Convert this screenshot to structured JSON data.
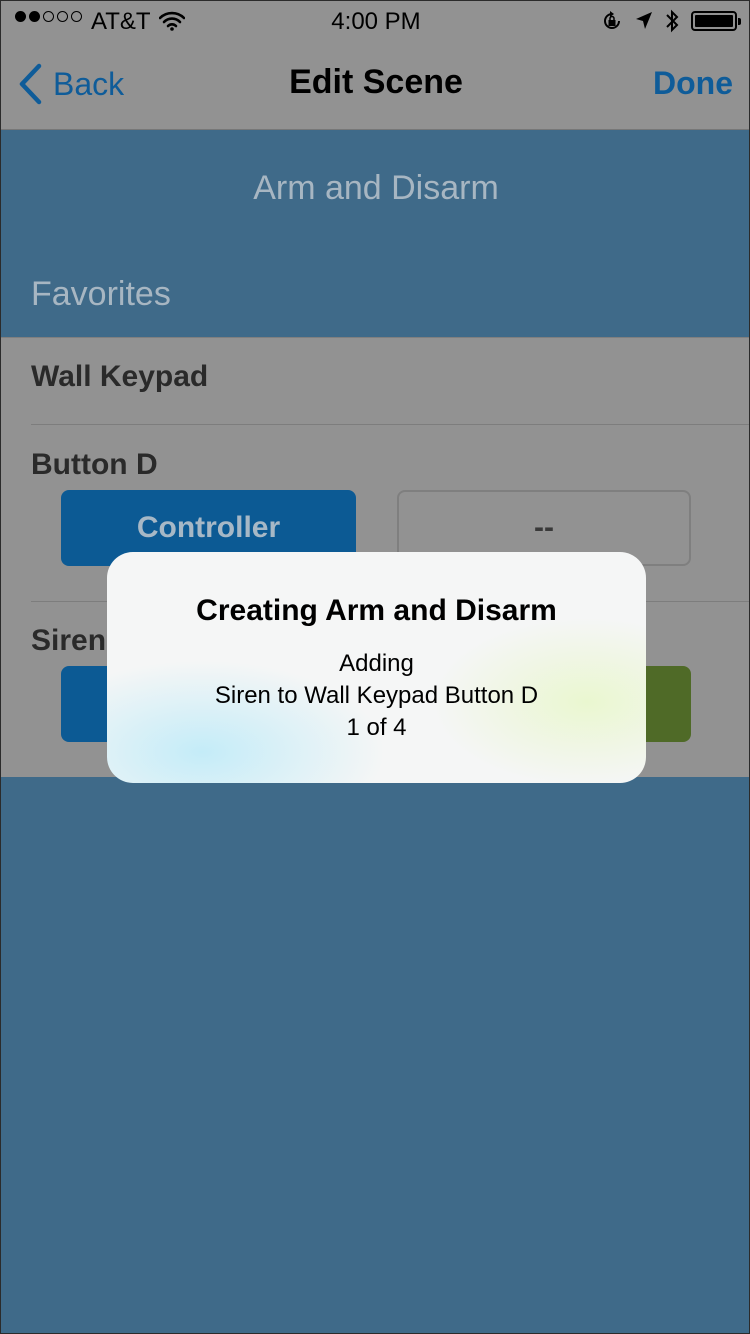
{
  "status_bar": {
    "carrier": "AT&T",
    "time": "4:00 PM",
    "signal_bars_filled": 2,
    "signal_bars_total": 5,
    "icons": [
      "signal-icon",
      "wifi-icon",
      "rotation-lock-icon",
      "location-icon",
      "bluetooth-icon",
      "battery-icon"
    ]
  },
  "nav": {
    "back_label": "Back",
    "title": "Edit Scene",
    "done_label": "Done"
  },
  "scene": {
    "name": "Arm and Disarm",
    "section_label": "Favorites"
  },
  "rows": [
    {
      "title": "Wall Keypad"
    },
    {
      "title": "Button D",
      "primary_button": "Controller",
      "secondary_button": "--"
    },
    {
      "title": "Siren"
    }
  ],
  "alert": {
    "title": "Creating Arm and Disarm",
    "line1": "Adding",
    "line2": "Siren to Wall Keypad Button D",
    "line3": "1 of 4"
  },
  "colors": {
    "accent_blue": "#0f5c99",
    "scene_background": "#3f6a89",
    "button_blue": "#0c5a94",
    "button_green": "#4f6a27"
  }
}
